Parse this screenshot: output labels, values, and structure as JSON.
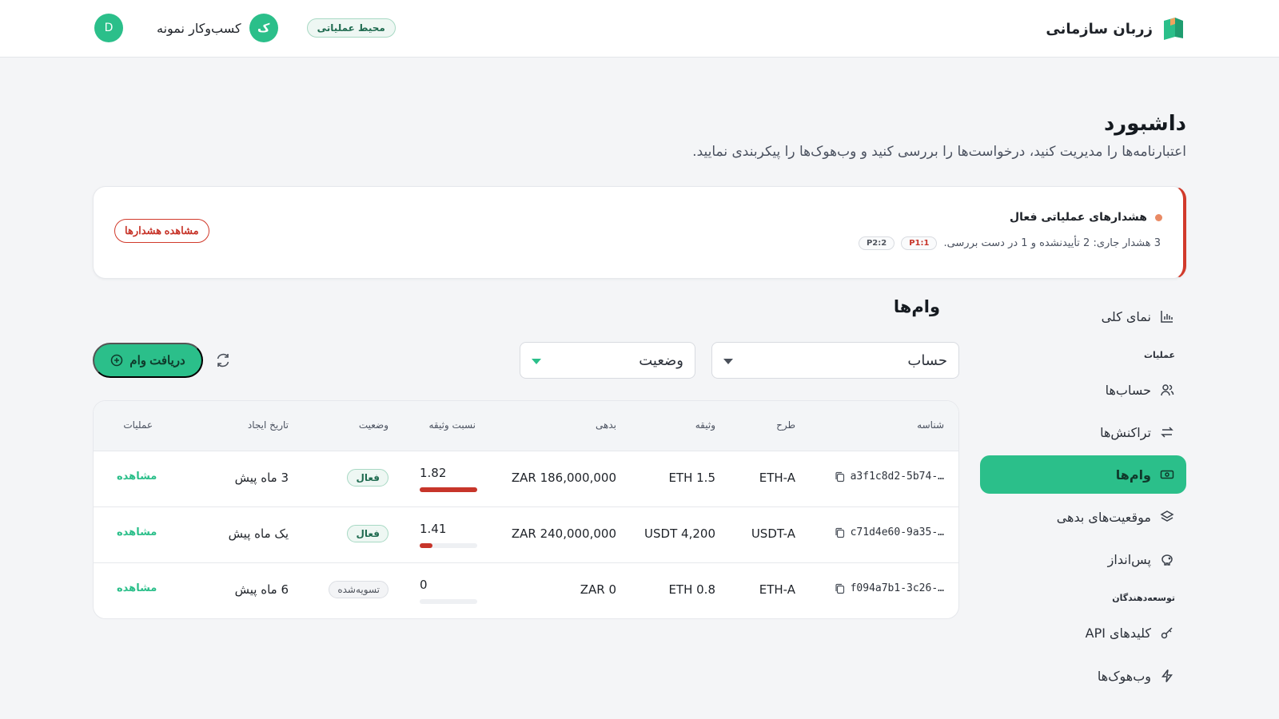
{
  "header": {
    "brand_name": "زربان سازمانی",
    "environment_badge": "محیط عملیاتی",
    "business_name": "کسب‌وکار نمونه",
    "business_avatar": "ک",
    "user_avatar": "D"
  },
  "page": {
    "title": "داشبورد",
    "subtitle": "اعتبارنامه‌ها را مدیریت کنید، درخواست‌ها را بررسی کنید و وب‌هوک‌ها را پیکربندی نمایید."
  },
  "alert": {
    "title": "هشدارهای عملیاتی فعال",
    "body": "3 هشدار جاری: 2 تأییدنشده و 1 در دست بررسی.",
    "chips": [
      "P1:1",
      "P2:2"
    ],
    "button_label": "مشاهده هشدارها"
  },
  "sidebar": {
    "overview": "نمای کلی",
    "section_operations": "عملیات",
    "accounts": "حساب‌ها",
    "transactions": "تراکنش‌ها",
    "loans": "وام‌ها",
    "debt_positions": "موقعیت‌های بدهی",
    "savings": "پس‌انداز",
    "section_developers": "توسعه‌دهندگان",
    "api_keys": "کلیدهای API",
    "webhooks": "وب‌هوک‌ها"
  },
  "loans": {
    "title": "وام‌ها",
    "account_select": "حساب",
    "status_select": "وضعیت",
    "get_loan_button": "دریافت وام",
    "columns": {
      "id": "شناسه",
      "plan": "طرح",
      "collateral": "وثیقه",
      "debt": "بدهی",
      "ratio": "نسبت وثیقه",
      "status": "وضعیت",
      "created": "تاریخ ایجاد",
      "actions": "عملیات"
    },
    "rows": [
      {
        "id": "a3f1c8d2-5b74-…",
        "plan": "ETH-A",
        "collateral": "1.5 ETH",
        "debt": "186,000,000 ZAR",
        "ratio": "1.82",
        "ratio_fill": 1.0,
        "status": "فعال",
        "status_kind": "active",
        "created": "3 ماه پیش",
        "action": "مشاهده"
      },
      {
        "id": "c71d4e60-9a35-…",
        "plan": "USDT-A",
        "collateral": "4,200 USDT",
        "debt": "240,000,000 ZAR",
        "ratio": "1.41",
        "ratio_fill": 0.22,
        "status": "فعال",
        "status_kind": "active",
        "created": "یک ماه پیش",
        "action": "مشاهده"
      },
      {
        "id": "f094a7b1-3c26-…",
        "plan": "ETH-A",
        "collateral": "0.8 ETH",
        "debt": "0 ZAR",
        "ratio": "0",
        "ratio_fill": 0,
        "status": "تسویه‌شده",
        "status_kind": "settled",
        "created": "6 ماه پیش",
        "action": "مشاهده"
      }
    ]
  },
  "colors": {
    "accent": "#2bbf8a",
    "danger": "#d13a2b",
    "background": "#f4f5f7"
  }
}
